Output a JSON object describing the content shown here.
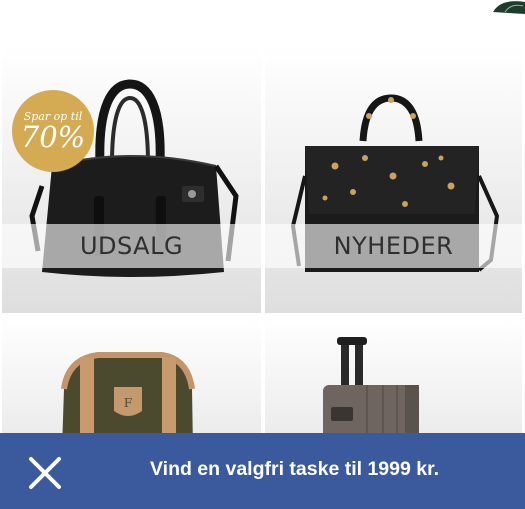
{
  "tiles": [
    {
      "label": "UDSALG",
      "badge": {
        "line1": "Spar op til",
        "line2": "70%"
      },
      "image": "black-leather-handbag"
    },
    {
      "label": "NYHEDER",
      "image": "black-studded-handbag"
    },
    {
      "label": "",
      "image": "olive-canvas-bag"
    },
    {
      "label": "",
      "image": "grey-suitcase"
    }
  ],
  "promo": {
    "close_icon": "close-icon",
    "text": "Vind en valgfri taske til 1999 kr.",
    "background": "#3b5a9d"
  },
  "colors": {
    "badge": "#d4aa52",
    "banner": "#3b5a9d"
  }
}
